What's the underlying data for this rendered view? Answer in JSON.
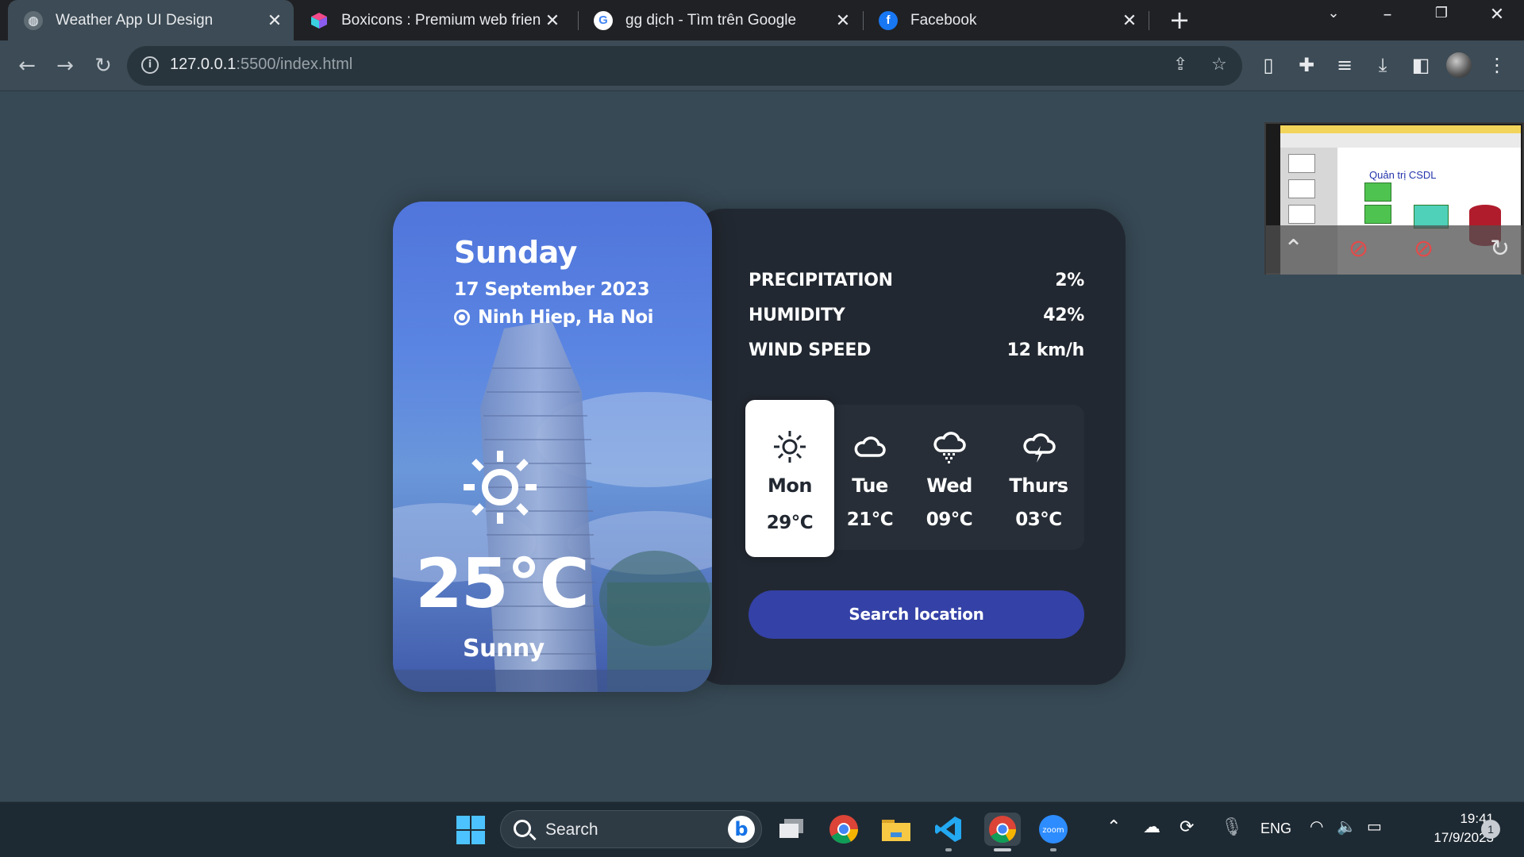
{
  "browser": {
    "tabs": [
      {
        "title": "Weather App UI Design",
        "active": true,
        "icon": "globe-icon"
      },
      {
        "title": "Boxicons : Premium web friendly",
        "active": false,
        "icon": "boxicons-icon"
      },
      {
        "title": "gg dịch - Tìm trên Google",
        "active": false,
        "icon": "google-icon"
      },
      {
        "title": "Facebook",
        "active": false,
        "icon": "facebook-icon"
      }
    ],
    "url_host": "127.0.0.1",
    "url_path": ":5500/index.html"
  },
  "weather": {
    "day": "Sunday",
    "date": "17 September 2023",
    "location": "Ninh Hiep, Ha Noi",
    "temperature": "25°C",
    "condition": "Sunny",
    "condition_icon": "sun-icon",
    "stats": [
      {
        "label": "PRECIPITATION",
        "value": "2%"
      },
      {
        "label": "HUMIDITY",
        "value": "42%"
      },
      {
        "label": "WIND SPEED",
        "value": "12 km/h"
      }
    ],
    "week": [
      {
        "day": "Mon",
        "temp": "29°C",
        "icon": "sun-icon",
        "active": true
      },
      {
        "day": "Tue",
        "temp": "21°C",
        "icon": "cloud-icon",
        "active": false
      },
      {
        "day": "Wed",
        "temp": "09°C",
        "icon": "cloud-snow-icon",
        "active": false
      },
      {
        "day": "Thurs",
        "temp": "03°C",
        "icon": "cloud-lightning-icon",
        "active": false
      }
    ],
    "search_label": "Search location"
  },
  "zoom_preview": {
    "slide_title": "Quản trị CSDL"
  },
  "taskbar": {
    "search_label": "Search",
    "language": "ENG",
    "time": "19:41",
    "date": "17/9/2023",
    "notification_count": "1"
  },
  "colors": {
    "page_bg": "#374955",
    "card_dark": "#222831",
    "accent_button": "#3441a6",
    "left_panel": "#5a87e0"
  }
}
